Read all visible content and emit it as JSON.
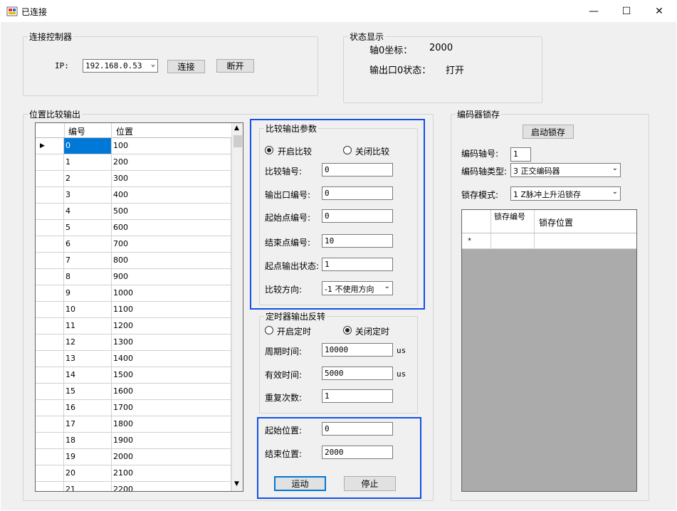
{
  "window": {
    "title": "已连接"
  },
  "connect": {
    "legend": "连接控制器",
    "ip_label": "IP:",
    "ip_value": "192.168.0.53",
    "connect_label": "连接",
    "disconnect_label": "断开"
  },
  "status": {
    "legend": "状态显示",
    "axis_label": "轴0坐标：",
    "axis_value": "2000",
    "out_label": "输出口0状态：",
    "out_value": "打开"
  },
  "pos_compare": {
    "legend": "位置比较输出",
    "headers": [
      "编号",
      "位置"
    ],
    "rows": [
      [
        "0",
        "100"
      ],
      [
        "1",
        "200"
      ],
      [
        "2",
        "300"
      ],
      [
        "3",
        "400"
      ],
      [
        "4",
        "500"
      ],
      [
        "5",
        "600"
      ],
      [
        "6",
        "700"
      ],
      [
        "7",
        "800"
      ],
      [
        "8",
        "900"
      ],
      [
        "9",
        "1000"
      ],
      [
        "10",
        "1100"
      ],
      [
        "11",
        "1200"
      ],
      [
        "12",
        "1300"
      ],
      [
        "13",
        "1400"
      ],
      [
        "14",
        "1500"
      ],
      [
        "15",
        "1600"
      ],
      [
        "16",
        "1700"
      ],
      [
        "17",
        "1800"
      ],
      [
        "18",
        "1900"
      ],
      [
        "19",
        "2000"
      ],
      [
        "20",
        "2100"
      ],
      [
        "21",
        "2200"
      ]
    ]
  },
  "compare_params": {
    "legend": "比较输出参数",
    "enable_label": "开启比较",
    "disable_label": "关闭比较",
    "enabled": true,
    "fields": [
      {
        "label": "比较轴号:",
        "value": "0"
      },
      {
        "label": "输出口编号:",
        "value": "0"
      },
      {
        "label": "起始点编号:",
        "value": "0"
      },
      {
        "label": "结束点编号:",
        "value": "10"
      },
      {
        "label": "起点输出状态:",
        "value": "1"
      }
    ],
    "direction_label": "比较方向:",
    "direction_value": "-1 不使用方向"
  },
  "timer": {
    "legend": "定时器输出反转",
    "enable_label": "开启定时",
    "disable_label": "关闭定时",
    "enabled": false,
    "period_label": "周期时间:",
    "period_value": "10000",
    "period_unit": "us",
    "valid_label": "有效时间:",
    "valid_value": "5000",
    "valid_unit": "us",
    "repeat_label": "重复次数:",
    "repeat_value": "1"
  },
  "motion": {
    "start_label": "起始位置:",
    "start_value": "0",
    "end_label": "结束位置:",
    "end_value": "2000",
    "move_label": "运动",
    "stop_label": "停止"
  },
  "encoder": {
    "legend": "编码器锁存",
    "start_label": "启动锁存",
    "axis_label": "编码轴号:",
    "axis_value": "1",
    "type_label": "编码轴类型:",
    "type_value": "3 正交编码器",
    "mode_label": "锁存模式:",
    "mode_value": "1 Z脉冲上升沿锁存",
    "grid_headers": [
      "锁存编号",
      "锁存位置"
    ],
    "new_row_marker": "*"
  },
  "colors": {
    "accent": "#1450e6",
    "focus": "#0078d7",
    "grid_empty": "#ababab",
    "selected_cell": "#0078d7"
  }
}
